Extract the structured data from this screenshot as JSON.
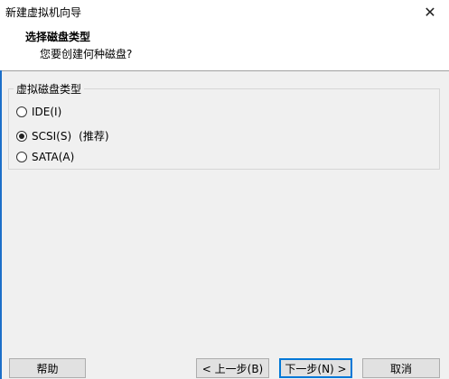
{
  "window": {
    "title": "新建虚拟机向导",
    "close_glyph": "✕"
  },
  "header": {
    "title": "选择磁盘类型",
    "subtitle": "您要创建何种磁盘?"
  },
  "group": {
    "legend": "虚拟磁盘类型",
    "options": [
      {
        "label": "IDE(I)",
        "selected": false,
        "suffix": ""
      },
      {
        "label": "SCSI(S)",
        "selected": true,
        "suffix": "(推荐)"
      },
      {
        "label": "SATA(A)",
        "selected": false,
        "suffix": ""
      }
    ]
  },
  "buttons": {
    "help": "帮助",
    "back": "< 上一步(B)",
    "next": "下一步(N) >",
    "cancel": "取消"
  },
  "colors": {
    "accent": "#0078d7",
    "edge": "#1c6fc9"
  }
}
